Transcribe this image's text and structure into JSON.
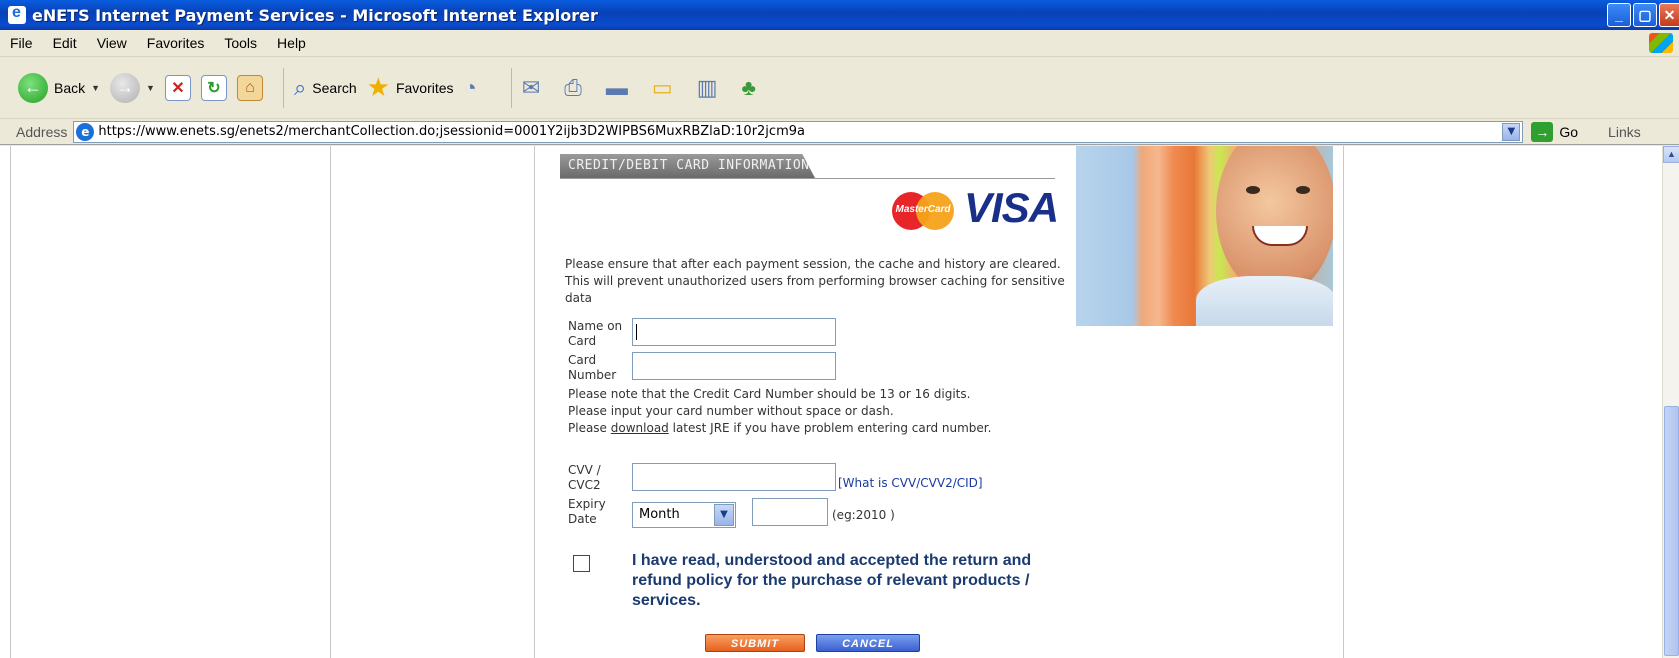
{
  "window": {
    "title": "eNETS Internet Payment Services - Microsoft Internet Explorer",
    "buttons": [
      "minimize",
      "maximize",
      "close"
    ]
  },
  "menu": {
    "items": [
      "File",
      "Edit",
      "View",
      "Favorites",
      "Tools",
      "Help"
    ]
  },
  "toolbar": {
    "back_label": "Back",
    "search_label": "Search",
    "favorites_label": "Favorites"
  },
  "address": {
    "label": "Address",
    "url": "https://www.enets.sg/enets2/merchantCollection.do;jsessionid=0001Y2ijb3D2WIPBS6MuxRBZlaD:10r2jcm9a",
    "go_label": "Go",
    "links_label": "Links"
  },
  "page": {
    "section_title": "CREDIT/DEBIT CARD INFORMATION",
    "mastercard_text": "MasterCard",
    "visa_text": "VISA",
    "notice": "Please ensure that after each payment session, the cache and history are cleared. This will prevent unauthorized users from performing browser caching for sensitive data",
    "form": {
      "name_label_1": "Name on",
      "name_label_2": "Card",
      "name_value": "",
      "card_label_1": "Card",
      "card_label_2": "Number",
      "card_value": "",
      "hint_digits": "Please note that the Credit Card Number should be 13 or 16 digits.",
      "hint_nospace": "Please input your card number without space or dash.",
      "hint_jre_prefix": "Please ",
      "hint_jre_link": "download",
      "hint_jre_suffix": " latest JRE if you have problem entering card number.",
      "cvv_label_1": "CVV /",
      "cvv_label_2": "CVC2",
      "cvv_value": "",
      "cvv_link": "[What is CVV/CVV2/CID]",
      "expiry_label_1": "Expiry",
      "expiry_label_2": "Date",
      "month_selected": "Month",
      "year_value": "",
      "year_hint": "(eg:2010 )",
      "policy_text": "I have read, understood and accepted the return and refund policy for the purchase of relevant products / services.",
      "policy_checked": false,
      "submit_label": "SUBMIT",
      "cancel_label": "CANCEL"
    }
  }
}
